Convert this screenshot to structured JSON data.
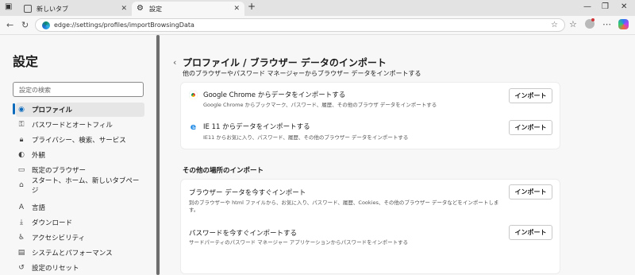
{
  "browser": {
    "tabs": [
      {
        "label": "新しいタブ"
      },
      {
        "label": "設定"
      }
    ],
    "url": "edge://settings/profiles/importBrowsingData",
    "new_tab_symbol": "+"
  },
  "sidebar": {
    "title": "設定",
    "search_placeholder": "設定の検索",
    "items": [
      {
        "label": "プロファイル",
        "icon": "profile-icon",
        "active": true
      },
      {
        "label": "パスワードとオートフィル",
        "icon": "key-icon"
      },
      {
        "label": "プライバシー、検索、サービス",
        "icon": "lock-icon"
      },
      {
        "label": "外観",
        "icon": "palette-icon"
      },
      {
        "label": "既定のブラウザー",
        "icon": "browser-icon"
      },
      {
        "label": "スタート、ホーム、新しいタブページ",
        "icon": "home-icon"
      },
      {
        "label": "言語",
        "icon": "language-icon"
      },
      {
        "label": "ダウンロード",
        "icon": "download-icon"
      },
      {
        "label": "アクセシビリティ",
        "icon": "accessibility-icon"
      },
      {
        "label": "システムとパフォーマンス",
        "icon": "system-icon"
      },
      {
        "label": "設定のリセット",
        "icon": "reset-icon"
      }
    ]
  },
  "main": {
    "title": "プロファイル / ブラウザー データのインポート",
    "subtitle": "他のブラウザーやパスワード マネージャーからブラウザー データをインポートする",
    "card1": [
      {
        "title": "Google Chrome からデータをインポートする",
        "desc": "Google Chrome からブックマーク、パスワード、履歴、その他のブラウザ データをインポートする",
        "button": "インポート",
        "icon": "chrome-icon"
      },
      {
        "title": "IE 11 からデータをインポートする",
        "desc": "IE11 からお気に入り、パスワード、履歴、その他のブラウザー データをインポートする",
        "button": "インポート",
        "icon": "ie-icon"
      }
    ],
    "section2_title": "その他の場所のインポート",
    "card2": [
      {
        "title": "ブラウザー データを今すぐインポート",
        "desc": "別のブラウザーや html ファイルから、お気に入り、パスワード、履歴、Cookies、その他のブラウザー データなどをインポートします。",
        "button": "インポート"
      },
      {
        "title": "パスワードを今すぐインポートする",
        "desc": "サードパーティのパスワード マネージャー アプリケーションからパスワードをインポートする",
        "button": "インポート"
      }
    ]
  }
}
